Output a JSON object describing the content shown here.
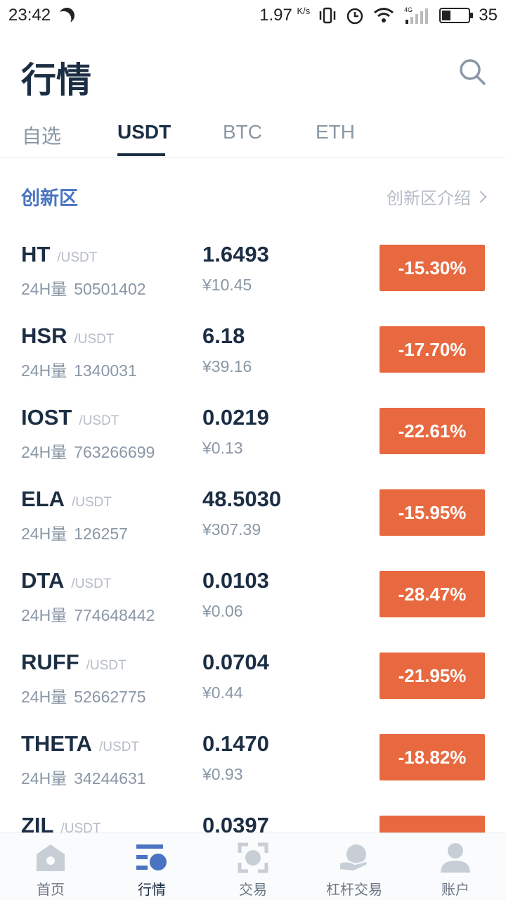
{
  "status_bar": {
    "time": "23:42",
    "speed": "1.97",
    "speed_unit": "K/s",
    "network": "4G",
    "battery": "35"
  },
  "header": {
    "title": "行情"
  },
  "tabs": [
    {
      "label": "自选",
      "active": false
    },
    {
      "label": "USDT",
      "active": true
    },
    {
      "label": "BTC",
      "active": false
    },
    {
      "label": "ETH",
      "active": false
    }
  ],
  "section": {
    "title": "创新区",
    "link_label": "创新区介绍"
  },
  "volume_label": "24H量",
  "rows": [
    {
      "symbol": "HT",
      "pair": "/USDT",
      "volume": "50501402",
      "price": "1.6493",
      "cny": "¥10.45",
      "change": "-15.30%"
    },
    {
      "symbol": "HSR",
      "pair": "/USDT",
      "volume": "1340031",
      "price": "6.18",
      "cny": "¥39.16",
      "change": "-17.70%"
    },
    {
      "symbol": "IOST",
      "pair": "/USDT",
      "volume": "763266699",
      "price": "0.0219",
      "cny": "¥0.13",
      "change": "-22.61%"
    },
    {
      "symbol": "ELA",
      "pair": "/USDT",
      "volume": "126257",
      "price": "48.5030",
      "cny": "¥307.39",
      "change": "-15.95%"
    },
    {
      "symbol": "DTA",
      "pair": "/USDT",
      "volume": "774648442",
      "price": "0.0103",
      "cny": "¥0.06",
      "change": "-28.47%"
    },
    {
      "symbol": "RUFF",
      "pair": "/USDT",
      "volume": "52662775",
      "price": "0.0704",
      "cny": "¥0.44",
      "change": "-21.95%"
    },
    {
      "symbol": "THETA",
      "pair": "/USDT",
      "volume": "34244631",
      "price": "0.1470",
      "cny": "¥0.93",
      "change": "-18.82%"
    },
    {
      "symbol": "ZIL",
      "pair": "/USDT",
      "volume": "",
      "price": "0.0397",
      "cny": "",
      "change": ""
    }
  ],
  "bottom_nav": [
    {
      "label": "首页",
      "icon": "home-icon",
      "active": false
    },
    {
      "label": "行情",
      "icon": "market-icon",
      "active": true
    },
    {
      "label": "交易",
      "icon": "trade-icon",
      "active": false
    },
    {
      "label": "杠杆交易",
      "icon": "margin-icon",
      "active": false
    },
    {
      "label": "账户",
      "icon": "account-icon",
      "active": false
    }
  ],
  "colors": {
    "accent": "#1c2e44",
    "section_title": "#4a74c1",
    "down": "#e8693f"
  }
}
